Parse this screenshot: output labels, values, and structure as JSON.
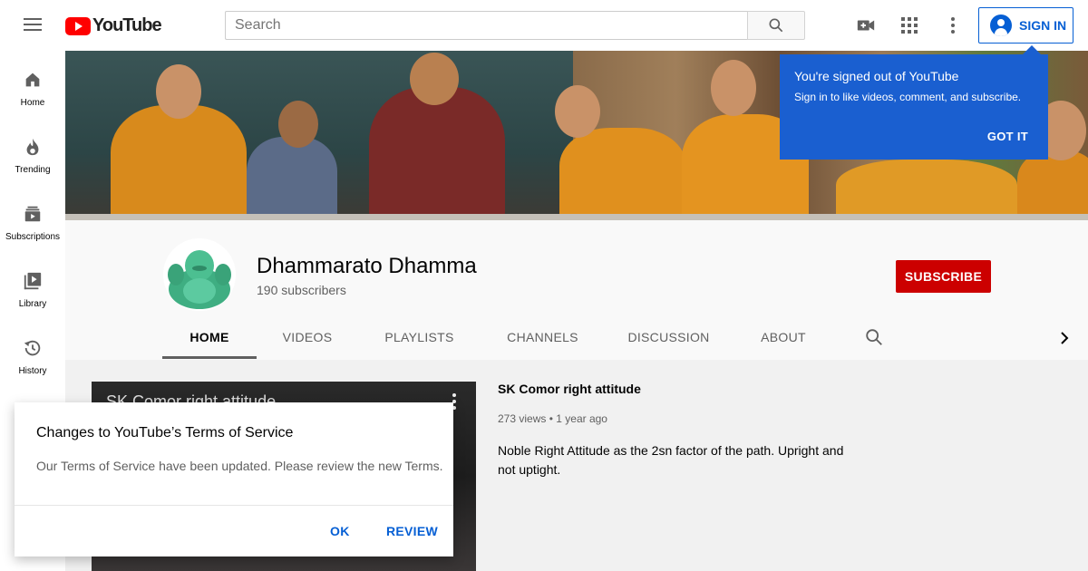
{
  "topbar": {
    "logo_text": "YouTube",
    "search_placeholder": "Search",
    "signin_label": "SIGN IN",
    "icons": [
      "menu-icon",
      "youtube-logo",
      "search-icon",
      "video-camera-icon",
      "apps-grid-icon",
      "more-vert-icon",
      "account-circle-icon"
    ]
  },
  "sidebar": {
    "items": [
      {
        "label": "Home",
        "icon": "home-icon"
      },
      {
        "label": "Trending",
        "icon": "flame-icon"
      },
      {
        "label": "Subscriptions",
        "icon": "subscriptions-icon"
      },
      {
        "label": "Library",
        "icon": "library-icon"
      },
      {
        "label": "History",
        "icon": "history-icon"
      }
    ]
  },
  "tooltip": {
    "title": "You're signed out of YouTube",
    "body": "Sign in to like videos, comment, and subscribe.",
    "button": "GOT IT"
  },
  "channel": {
    "name": "Dhammarato Dhamma",
    "subscribers": "190 subscribers",
    "subscribe_label": "SUBSCRIBE",
    "tabs": [
      "HOME",
      "VIDEOS",
      "PLAYLISTS",
      "CHANNELS",
      "DISCUSSION",
      "ABOUT"
    ],
    "active_tab": "HOME"
  },
  "video": {
    "thumb_title": "SK Comor right attitude",
    "title": "SK Comor right attitude",
    "views": "273 views",
    "age": "1 year ago",
    "description": "Noble Right Attitude as the 2sn factor of the path. Upright and not uptight."
  },
  "dialog": {
    "title": "Changes to YouTube’s Terms of Service",
    "body": "Our Terms of Service have been updated. Please review the new Terms.",
    "ok_label": "OK",
    "review_label": "REVIEW"
  },
  "colors": {
    "youtube_red": "#ff0000",
    "subscribe_red": "#cc0000",
    "link_blue": "#065fd4",
    "tooltip_blue": "#1a5fd0"
  }
}
